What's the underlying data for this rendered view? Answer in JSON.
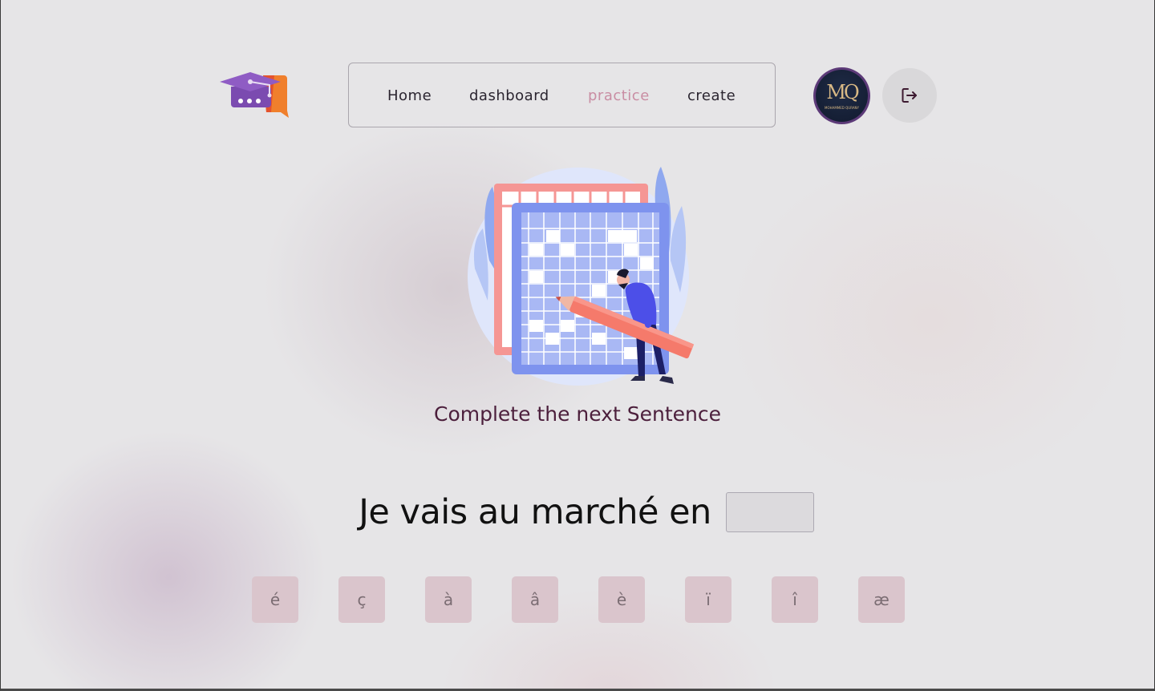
{
  "nav": {
    "items": [
      {
        "label": "Home",
        "active": false
      },
      {
        "label": "dashboard",
        "active": false
      },
      {
        "label": "practice",
        "active": true
      },
      {
        "label": "create",
        "active": false
      }
    ]
  },
  "user": {
    "initials": "MQ",
    "name": "MOHAMMED QURANY"
  },
  "icons": {
    "logo": "graduation-cap-chat-logo",
    "logout": "logout-icon",
    "illustration": "crossword-puzzle-illustration"
  },
  "exercise": {
    "prompt": "Complete the next Sentence",
    "sentence": "Je vais au marché en",
    "answer_value": ""
  },
  "special_characters": [
    "é",
    "ç",
    "à",
    "â",
    "è",
    "ï",
    "î",
    "æ"
  ],
  "colors": {
    "nav_active": "#c98da3",
    "prompt_text": "#4c1f3c",
    "key_background": "#dac5cc",
    "logo_purple": "#7b4bb0",
    "logo_orange": "#f07f2c"
  }
}
